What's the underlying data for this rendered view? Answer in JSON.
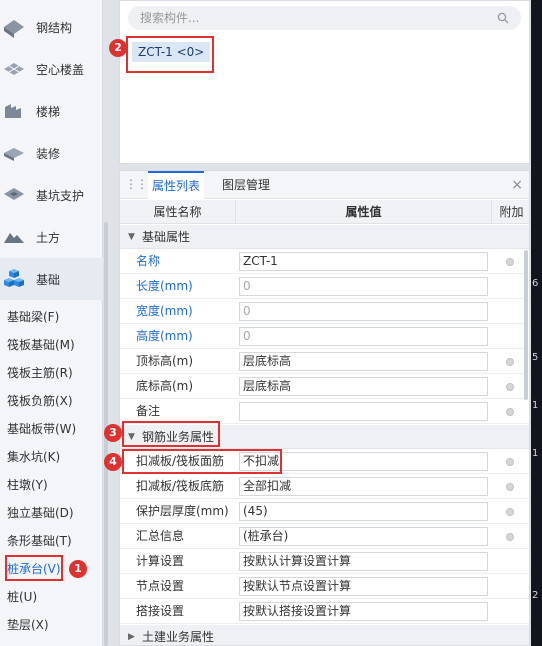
{
  "sidebar": {
    "categories": [
      {
        "label": "钢结构",
        "icon": "steel-structure-icon"
      },
      {
        "label": "空心楼盖",
        "icon": "hollow-floor-icon"
      },
      {
        "label": "楼梯",
        "icon": "stairs-icon"
      },
      {
        "label": "装修",
        "icon": "decoration-icon"
      },
      {
        "label": "基坑支护",
        "icon": "pit-support-icon"
      },
      {
        "label": "土方",
        "icon": "earthwork-icon"
      },
      {
        "label": "基础",
        "icon": "foundation-icon"
      }
    ],
    "subitems": [
      "基础梁(F)",
      "筏板基础(M)",
      "筏板主筋(R)",
      "筏板负筋(X)",
      "基础板带(W)",
      "集水坑(K)",
      "柱墩(Y)",
      "独立基础(D)",
      "条形基础(T)",
      "桩承台(V)",
      "桩(U)",
      "垫层(X)"
    ],
    "selected_subitem": "桩承台(V)"
  },
  "component_panel": {
    "search_placeholder": "搜索构件...",
    "component": "ZCT-1 <0>"
  },
  "property_panel": {
    "tabs": [
      "属性列表",
      "图层管理"
    ],
    "active_tab": "属性列表",
    "close": "×",
    "columns": {
      "name": "属性名称",
      "value": "属性值",
      "extra": "附加"
    },
    "groups": {
      "basic": "基础属性",
      "rebar": "钢筋业务属性",
      "civil": "土建业务属性"
    },
    "basic_rows": [
      {
        "name": "名称",
        "value": "ZCT-1",
        "blue": true,
        "dot": true
      },
      {
        "name": "长度(mm)",
        "value": "0",
        "blue": true,
        "dot": false
      },
      {
        "name": "宽度(mm)",
        "value": "0",
        "blue": true,
        "dot": false
      },
      {
        "name": "高度(mm)",
        "value": "0",
        "blue": true,
        "dot": false
      },
      {
        "name": "顶标高(m)",
        "value": "层底标高",
        "blue": false,
        "dot": true
      },
      {
        "name": "底标高(m)",
        "value": "层底标高",
        "blue": false,
        "dot": true
      },
      {
        "name": "备注",
        "value": "",
        "blue": false,
        "dot": true
      }
    ],
    "rebar_rows": [
      {
        "name": "扣减板/筏板面筋",
        "value": "不扣减",
        "dot": true
      },
      {
        "name": "扣减板/筏板底筋",
        "value": "全部扣减",
        "dot": true
      },
      {
        "name": "保护层厚度(mm)",
        "value": "(45)",
        "dot": true
      },
      {
        "name": "汇总信息",
        "value": "(桩承台)",
        "dot": true
      },
      {
        "name": "计算设置",
        "value": "按默认计算设置计算",
        "dot": false
      },
      {
        "name": "节点设置",
        "value": "按默认节点设置计算",
        "dot": false
      },
      {
        "name": "搭接设置",
        "value": "按默认搭接设置计算",
        "dot": false
      }
    ]
  },
  "annotations": [
    "1",
    "2",
    "3",
    "4"
  ],
  "canvas_glyphs": [
    "6",
    "5",
    "1",
    "1",
    "2"
  ],
  "colors": {
    "accent": "#1e6bd6",
    "marker": "#e03131"
  }
}
